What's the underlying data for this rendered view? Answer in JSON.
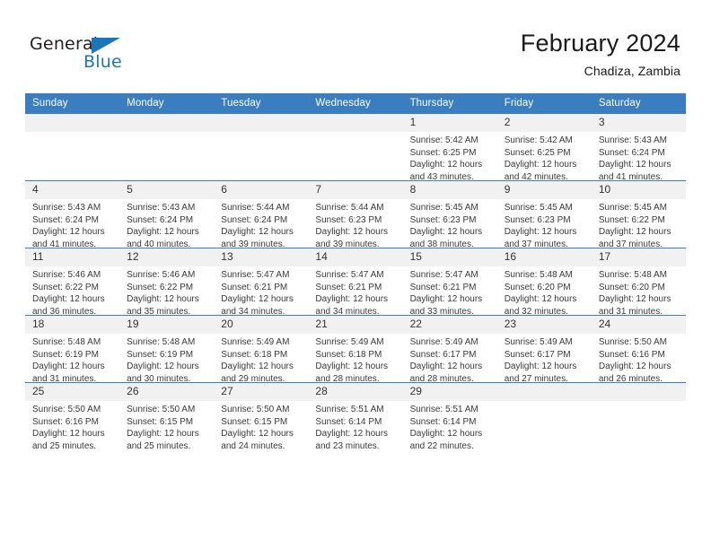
{
  "logo": {
    "word_one": "General",
    "word_two": "Blue",
    "triangle_icon": "triangle-icon",
    "brand_color": "#1b75bb"
  },
  "header": {
    "month_title": "February 2024",
    "location": "Chadiza, Zambia"
  },
  "theme": {
    "header_blue": "#3a7ec0",
    "daynum_band": "#f1f1f1",
    "text": "#3a3a3a"
  },
  "weekday_headers": [
    "Sunday",
    "Monday",
    "Tuesday",
    "Wednesday",
    "Thursday",
    "Friday",
    "Saturday"
  ],
  "labels": {
    "sunrise_prefix": "Sunrise: ",
    "sunset_prefix": "Sunset: ",
    "daylight_prefix": "Daylight: "
  },
  "weeks": [
    [
      {
        "day": "",
        "empty": true
      },
      {
        "day": "",
        "empty": true
      },
      {
        "day": "",
        "empty": true
      },
      {
        "day": "",
        "empty": true
      },
      {
        "day": "1",
        "sunrise": "Sunrise: 5:42 AM",
        "sunset": "Sunset: 6:25 PM",
        "daylight": "Daylight: 12 hours and 43 minutes."
      },
      {
        "day": "2",
        "sunrise": "Sunrise: 5:42 AM",
        "sunset": "Sunset: 6:25 PM",
        "daylight": "Daylight: 12 hours and 42 minutes."
      },
      {
        "day": "3",
        "sunrise": "Sunrise: 5:43 AM",
        "sunset": "Sunset: 6:24 PM",
        "daylight": "Daylight: 12 hours and 41 minutes."
      }
    ],
    [
      {
        "day": "4",
        "sunrise": "Sunrise: 5:43 AM",
        "sunset": "Sunset: 6:24 PM",
        "daylight": "Daylight: 12 hours and 41 minutes."
      },
      {
        "day": "5",
        "sunrise": "Sunrise: 5:43 AM",
        "sunset": "Sunset: 6:24 PM",
        "daylight": "Daylight: 12 hours and 40 minutes."
      },
      {
        "day": "6",
        "sunrise": "Sunrise: 5:44 AM",
        "sunset": "Sunset: 6:24 PM",
        "daylight": "Daylight: 12 hours and 39 minutes."
      },
      {
        "day": "7",
        "sunrise": "Sunrise: 5:44 AM",
        "sunset": "Sunset: 6:23 PM",
        "daylight": "Daylight: 12 hours and 39 minutes."
      },
      {
        "day": "8",
        "sunrise": "Sunrise: 5:45 AM",
        "sunset": "Sunset: 6:23 PM",
        "daylight": "Daylight: 12 hours and 38 minutes."
      },
      {
        "day": "9",
        "sunrise": "Sunrise: 5:45 AM",
        "sunset": "Sunset: 6:23 PM",
        "daylight": "Daylight: 12 hours and 37 minutes."
      },
      {
        "day": "10",
        "sunrise": "Sunrise: 5:45 AM",
        "sunset": "Sunset: 6:22 PM",
        "daylight": "Daylight: 12 hours and 37 minutes."
      }
    ],
    [
      {
        "day": "11",
        "sunrise": "Sunrise: 5:46 AM",
        "sunset": "Sunset: 6:22 PM",
        "daylight": "Daylight: 12 hours and 36 minutes."
      },
      {
        "day": "12",
        "sunrise": "Sunrise: 5:46 AM",
        "sunset": "Sunset: 6:22 PM",
        "daylight": "Daylight: 12 hours and 35 minutes."
      },
      {
        "day": "13",
        "sunrise": "Sunrise: 5:47 AM",
        "sunset": "Sunset: 6:21 PM",
        "daylight": "Daylight: 12 hours and 34 minutes."
      },
      {
        "day": "14",
        "sunrise": "Sunrise: 5:47 AM",
        "sunset": "Sunset: 6:21 PM",
        "daylight": "Daylight: 12 hours and 34 minutes."
      },
      {
        "day": "15",
        "sunrise": "Sunrise: 5:47 AM",
        "sunset": "Sunset: 6:21 PM",
        "daylight": "Daylight: 12 hours and 33 minutes."
      },
      {
        "day": "16",
        "sunrise": "Sunrise: 5:48 AM",
        "sunset": "Sunset: 6:20 PM",
        "daylight": "Daylight: 12 hours and 32 minutes."
      },
      {
        "day": "17",
        "sunrise": "Sunrise: 5:48 AM",
        "sunset": "Sunset: 6:20 PM",
        "daylight": "Daylight: 12 hours and 31 minutes."
      }
    ],
    [
      {
        "day": "18",
        "sunrise": "Sunrise: 5:48 AM",
        "sunset": "Sunset: 6:19 PM",
        "daylight": "Daylight: 12 hours and 31 minutes."
      },
      {
        "day": "19",
        "sunrise": "Sunrise: 5:48 AM",
        "sunset": "Sunset: 6:19 PM",
        "daylight": "Daylight: 12 hours and 30 minutes."
      },
      {
        "day": "20",
        "sunrise": "Sunrise: 5:49 AM",
        "sunset": "Sunset: 6:18 PM",
        "daylight": "Daylight: 12 hours and 29 minutes."
      },
      {
        "day": "21",
        "sunrise": "Sunrise: 5:49 AM",
        "sunset": "Sunset: 6:18 PM",
        "daylight": "Daylight: 12 hours and 28 minutes."
      },
      {
        "day": "22",
        "sunrise": "Sunrise: 5:49 AM",
        "sunset": "Sunset: 6:17 PM",
        "daylight": "Daylight: 12 hours and 28 minutes."
      },
      {
        "day": "23",
        "sunrise": "Sunrise: 5:49 AM",
        "sunset": "Sunset: 6:17 PM",
        "daylight": "Daylight: 12 hours and 27 minutes."
      },
      {
        "day": "24",
        "sunrise": "Sunrise: 5:50 AM",
        "sunset": "Sunset: 6:16 PM",
        "daylight": "Daylight: 12 hours and 26 minutes."
      }
    ],
    [
      {
        "day": "25",
        "sunrise": "Sunrise: 5:50 AM",
        "sunset": "Sunset: 6:16 PM",
        "daylight": "Daylight: 12 hours and 25 minutes."
      },
      {
        "day": "26",
        "sunrise": "Sunrise: 5:50 AM",
        "sunset": "Sunset: 6:15 PM",
        "daylight": "Daylight: 12 hours and 25 minutes."
      },
      {
        "day": "27",
        "sunrise": "Sunrise: 5:50 AM",
        "sunset": "Sunset: 6:15 PM",
        "daylight": "Daylight: 12 hours and 24 minutes."
      },
      {
        "day": "28",
        "sunrise": "Sunrise: 5:51 AM",
        "sunset": "Sunset: 6:14 PM",
        "daylight": "Daylight: 12 hours and 23 minutes."
      },
      {
        "day": "29",
        "sunrise": "Sunrise: 5:51 AM",
        "sunset": "Sunset: 6:14 PM",
        "daylight": "Daylight: 12 hours and 22 minutes."
      },
      {
        "day": "",
        "empty": true
      },
      {
        "day": "",
        "empty": true
      }
    ]
  ]
}
